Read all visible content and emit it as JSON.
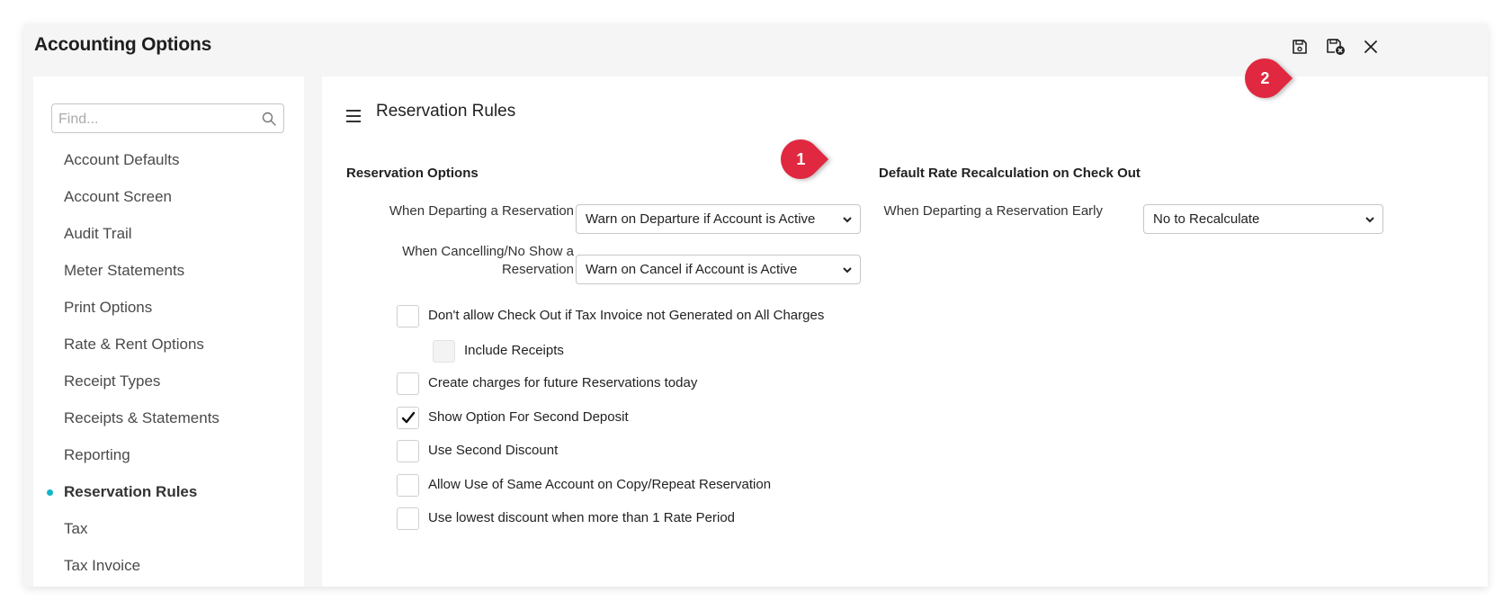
{
  "window": {
    "title": "Accounting Options"
  },
  "toolbar": {
    "icons": [
      "save-icon",
      "save-and-exit-icon",
      "close-icon"
    ]
  },
  "sidebar": {
    "search_placeholder": "Find...",
    "items": [
      {
        "label": "Account Defaults"
      },
      {
        "label": "Account Screen"
      },
      {
        "label": "Audit Trail"
      },
      {
        "label": "Meter Statements"
      },
      {
        "label": "Print Options"
      },
      {
        "label": "Rate & Rent Options"
      },
      {
        "label": "Receipt Types"
      },
      {
        "label": "Receipts & Statements"
      },
      {
        "label": "Reporting"
      },
      {
        "label": "Reservation Rules",
        "active": true
      },
      {
        "label": "Tax"
      },
      {
        "label": "Tax Invoice"
      }
    ]
  },
  "main": {
    "section_title": "Reservation Rules",
    "reservation_options": {
      "heading": "Reservation Options",
      "departing_label": "When Departing a Reservation",
      "departing_value": "Warn on Departure if Account is Active",
      "cancel_label_line1": "When Cancelling/No Show a",
      "cancel_label_line2": "Reservation",
      "cancel_value": "Warn on Cancel if Account is Active"
    },
    "rate_recalc": {
      "heading": "Default Rate Recalculation on Check Out",
      "early_label": "When Departing a Reservation Early",
      "early_value": "No to Recalculate"
    },
    "checkboxes": [
      {
        "label": "Don't allow Check Out if Tax Invoice not Generated on All Charges",
        "checked": false
      },
      {
        "label": "Include Receipts",
        "checked": false,
        "disabled": true
      },
      {
        "label": "Create charges for future Reservations today",
        "checked": false
      },
      {
        "label": "Show Option For Second Deposit",
        "checked": true
      },
      {
        "label": "Use Second Discount",
        "checked": false
      },
      {
        "label": "Allow Use of Same Account on Copy/Repeat Reservation",
        "checked": false
      },
      {
        "label": "Use lowest discount when more than 1 Rate Period",
        "checked": false
      }
    ]
  },
  "annotations": {
    "marker1": "1",
    "marker2": "2"
  },
  "colors": {
    "accent_dot": "#12b5c9",
    "marker_red": "#e02840"
  }
}
